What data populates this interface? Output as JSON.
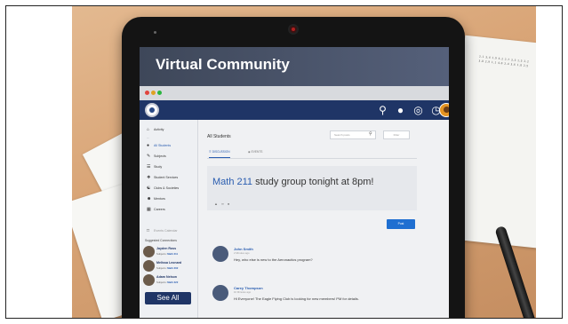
{
  "hero": {
    "title": "Virtual Community"
  },
  "appnav": {
    "icons": [
      "search-icon",
      "chat-icon",
      "globe-icon",
      "alarm-icon",
      "avatar"
    ]
  },
  "sidebar": {
    "items": [
      {
        "label": "Activity",
        "icon": "home-icon"
      },
      {
        "label": "All Students",
        "icon": "students-icon"
      },
      {
        "label": "Subjects",
        "icon": "subjects-icon"
      },
      {
        "label": "Study",
        "icon": "study-icon"
      },
      {
        "label": "Student Services",
        "icon": "services-icon"
      },
      {
        "label": "Clubs & Societies",
        "icon": "clubs-icon"
      },
      {
        "label": "Mentors",
        "icon": "mentors-icon"
      },
      {
        "label": "Careers",
        "icon": "careers-icon"
      },
      {
        "label": "Events Calendar",
        "icon": "calendar-icon"
      }
    ],
    "suggested_title": "Suggested Connections",
    "connections": [
      {
        "name": "Jayden Ross",
        "subject_prefix": "Subjects:",
        "subject": "Math 211"
      },
      {
        "name": "Melissa Leonard",
        "subject_prefix": "Subjects:",
        "subject": "Math 202"
      },
      {
        "name": "Adam Nelson",
        "subject_prefix": "Subjects:",
        "subject": "Math 222"
      }
    ],
    "see_all": "See All"
  },
  "main": {
    "title": "All Students",
    "search_placeholder": "Search posts",
    "filter_label": "Filter",
    "tabs": [
      {
        "label": "DISCUSSION",
        "active": true
      },
      {
        "label": "EVENTS",
        "active": false
      }
    ],
    "post": {
      "highlight": "Math 211",
      "rest": " study group tonight at 8pm!"
    },
    "post_button": "Post",
    "feed": [
      {
        "name": "John Smith",
        "time": "2 Minutes ago",
        "message": "Hey, who else is new to the Aeronautics program?"
      },
      {
        "name": "Carey Thompson",
        "time": "10 Minutes ago",
        "message": "Hi Everyone! The Eagle Flying Club is looking for new members! PM for details."
      }
    ]
  },
  "colors": {
    "nav": "#1f3566",
    "accent": "#2a5db0",
    "hero": "#3e4759",
    "button": "#1f6fd1"
  }
}
